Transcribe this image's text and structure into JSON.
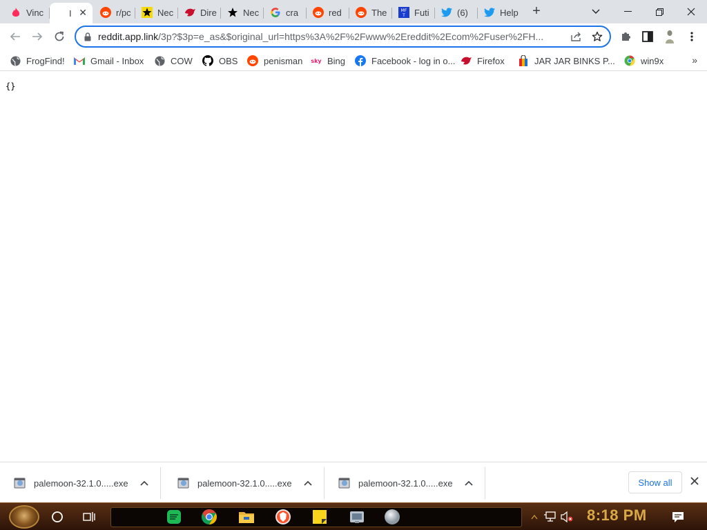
{
  "tabs": [
    {
      "title": "Vinc",
      "icon": "tinder-flame-icon"
    },
    {
      "title": "I",
      "icon": "none",
      "active": true
    },
    {
      "title": "r/pc",
      "icon": "reddit-icon"
    },
    {
      "title": "Nec",
      "icon": "star-icon"
    },
    {
      "title": "Dire",
      "icon": "red-bird-icon"
    },
    {
      "title": "Nec",
      "icon": "star-icon"
    },
    {
      "title": "cra",
      "icon": "google-icon"
    },
    {
      "title": "red",
      "icon": "reddit-icon"
    },
    {
      "title": "The",
      "icon": "reddit-icon"
    },
    {
      "title": "Futi",
      "icon": "mft-icon"
    },
    {
      "title": "(6)",
      "icon": "twitter-icon"
    },
    {
      "title": "Help",
      "icon": "twitter-icon"
    }
  ],
  "new_tab_label": "+",
  "address_bar": {
    "host": "reddit.app.link",
    "path": "/3p?$3p=e_as&$original_url=https%3A%2F%2Fwww%2Ereddit%2Ecom%2Fuser%2FH..."
  },
  "bookmarks": [
    {
      "label": "FrogFind!",
      "icon": "globe-icon"
    },
    {
      "label": "Gmail - Inbox",
      "icon": "gmail-icon"
    },
    {
      "label": "COW",
      "icon": "globe-icon"
    },
    {
      "label": "OBS",
      "icon": "github-icon"
    },
    {
      "label": "penisman",
      "icon": "reddit-icon"
    },
    {
      "label": "Bing",
      "icon": "sky-icon"
    },
    {
      "label": "Facebook - log in o...",
      "icon": "facebook-icon"
    },
    {
      "label": "Firefox",
      "icon": "red-bird-icon"
    },
    {
      "label": "JAR JAR BINKS P...",
      "icon": "shopping-bag-icon"
    },
    {
      "label": "win9x",
      "icon": "chrome-old-icon"
    }
  ],
  "page_body": "{}",
  "downloads": [
    {
      "filename": "palemoon-32.1.0.....exe"
    },
    {
      "filename": "palemoon-32.1.0.....exe"
    },
    {
      "filename": "palemoon-32.1.0.....exe"
    }
  ],
  "show_all_label": "Show all",
  "clock": "8:18 PM",
  "colors": {
    "accent": "#1a73e8",
    "tabstrip": "#dee1e6",
    "taskbar": "#3a1c0a",
    "clock": "#d9a948"
  }
}
